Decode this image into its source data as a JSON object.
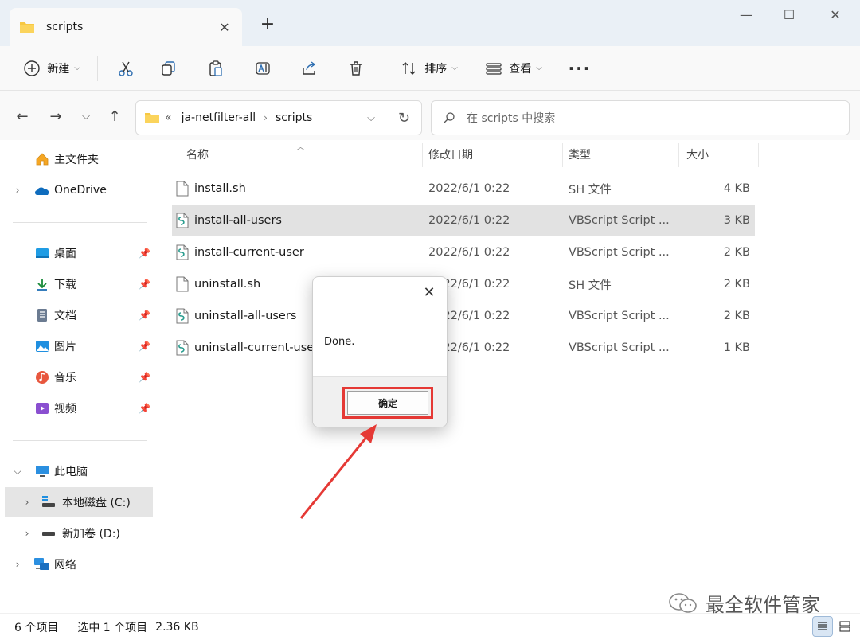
{
  "window": {
    "tab_title": "scripts",
    "colors": {
      "accent": "#0067c0",
      "folder": "#f7c843",
      "highlight": "#e53935"
    }
  },
  "commandbar": {
    "new_label": "新建",
    "sort_label": "排序",
    "view_label": "查看",
    "icons": [
      "cut-icon",
      "copy-icon",
      "paste-icon",
      "rename-icon",
      "share-icon",
      "delete-icon"
    ]
  },
  "address": {
    "overflow": "«",
    "crumbs": [
      "ja-netfilter-all",
      "scripts"
    ]
  },
  "search": {
    "placeholder": "在 scripts 中搜索"
  },
  "sidebar": {
    "home": "主文件夹",
    "onedrive": "OneDrive",
    "quick": [
      {
        "label": "桌面",
        "icon": "desktop-icon"
      },
      {
        "label": "下载",
        "icon": "download-icon"
      },
      {
        "label": "文档",
        "icon": "documents-icon"
      },
      {
        "label": "图片",
        "icon": "pictures-icon"
      },
      {
        "label": "音乐",
        "icon": "music-icon"
      },
      {
        "label": "视频",
        "icon": "videos-icon"
      }
    ],
    "thispc": "此电脑",
    "drive_c": "本地磁盘 (C:)",
    "drive_d": "新加卷 (D:)",
    "network": "网络"
  },
  "columns": {
    "name": "名称",
    "date": "修改日期",
    "type": "类型",
    "size": "大小"
  },
  "files": [
    {
      "name": "install.sh",
      "date": "2022/6/1 0:22",
      "type": "SH 文件",
      "size": "4 KB",
      "kind": "sh"
    },
    {
      "name": "install-all-users",
      "date": "2022/6/1 0:22",
      "type": "VBScript Script ...",
      "size": "3 KB",
      "kind": "vbs"
    },
    {
      "name": "install-current-user",
      "date": "2022/6/1 0:22",
      "type": "VBScript Script ...",
      "size": "2 KB",
      "kind": "vbs"
    },
    {
      "name": "uninstall.sh",
      "date": "2022/6/1 0:22",
      "type": "SH 文件",
      "size": "2 KB",
      "kind": "sh"
    },
    {
      "name": "uninstall-all-users",
      "date": "2022/6/1 0:22",
      "type": "VBScript Script ...",
      "size": "2 KB",
      "kind": "vbs"
    },
    {
      "name": "uninstall-current-user",
      "date": "2022/6/1 0:22",
      "type": "VBScript Script ...",
      "size": "1 KB",
      "kind": "vbs"
    }
  ],
  "status": {
    "count": "6 个项目",
    "selection": "选中 1 个项目",
    "size": "2.36 KB"
  },
  "dialog": {
    "message": "Done.",
    "ok_label": "确定"
  },
  "watermark": {
    "text": "最全软件管家"
  }
}
